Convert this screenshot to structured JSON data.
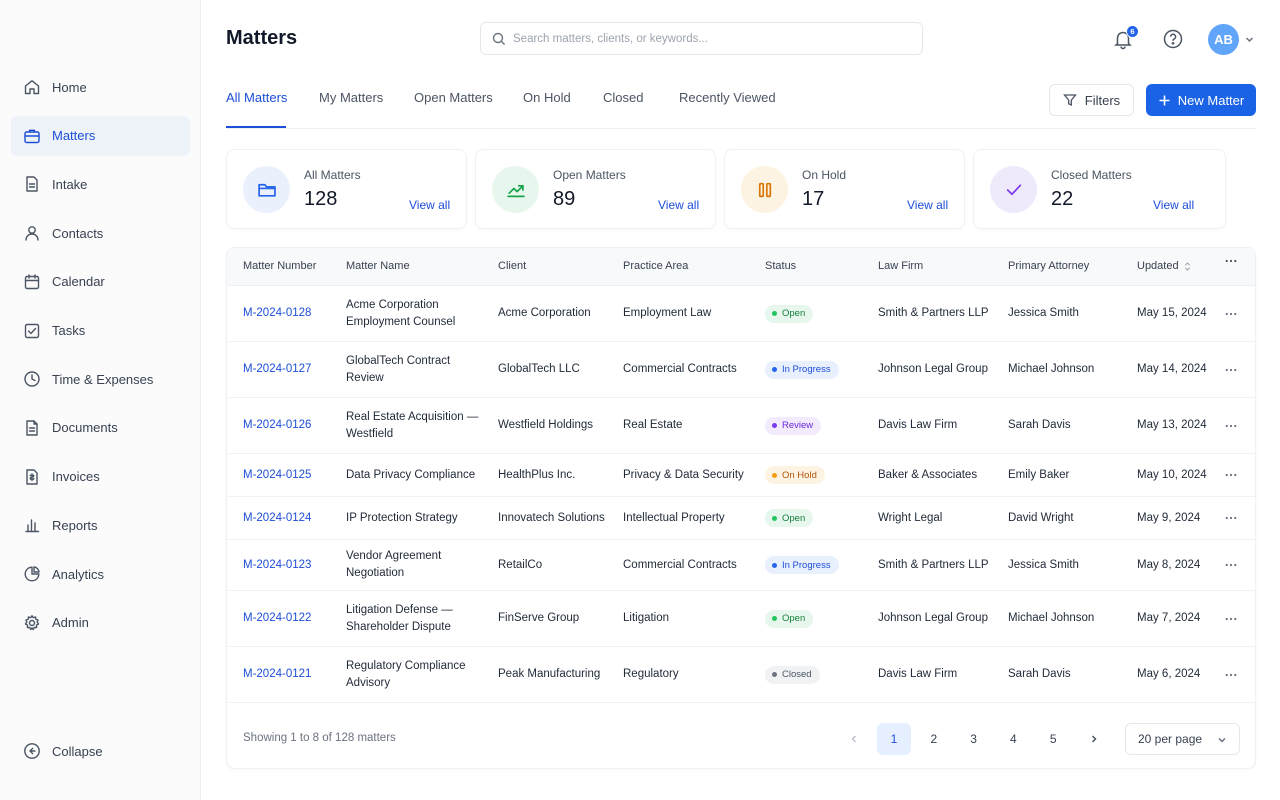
{
  "app": {
    "title": "Matters"
  },
  "sidebar": {
    "items": [
      {
        "label": "Home",
        "icon": "home-icon",
        "active": false
      },
      {
        "label": "Matters",
        "icon": "briefcase-icon",
        "active": true
      },
      {
        "label": "Intake",
        "icon": "intake-icon",
        "active": false
      },
      {
        "label": "Contacts",
        "icon": "user-icon",
        "active": false
      },
      {
        "label": "Calendar",
        "icon": "calendar-icon",
        "active": false
      },
      {
        "label": "Tasks",
        "icon": "checkbox-icon",
        "active": false
      },
      {
        "label": "Time & Expenses",
        "icon": "clock-icon",
        "active": false
      },
      {
        "label": "Documents",
        "icon": "document-icon",
        "active": false
      },
      {
        "label": "Invoices",
        "icon": "invoice-icon",
        "active": false
      },
      {
        "label": "Reports",
        "icon": "bar-chart-icon",
        "active": false
      },
      {
        "label": "Analytics",
        "icon": "pie-chart-icon",
        "active": false
      },
      {
        "label": "Admin",
        "icon": "gear-icon",
        "active": false
      }
    ],
    "collapse_label": "Collapse"
  },
  "search": {
    "placeholder": "Search matters, clients, or keywords..."
  },
  "notifications": {
    "count": "6"
  },
  "user": {
    "initials": "AB"
  },
  "tabs": [
    {
      "label": "All Matters",
      "active": true
    },
    {
      "label": "My Matters",
      "active": false
    },
    {
      "label": "Open Matters",
      "active": false
    },
    {
      "label": "On Hold",
      "active": false
    },
    {
      "label": "Closed",
      "active": false
    },
    {
      "label": "Recently Viewed",
      "active": false
    }
  ],
  "toolbar": {
    "filters_label": "Filters",
    "new_label": "New Matter"
  },
  "stats": [
    {
      "label": "All Matters",
      "value": "128",
      "link": "View all",
      "icon": "folder-icon",
      "icon_color": "#2563eb",
      "icon_bg": "#eaf1fd"
    },
    {
      "label": "Open Matters",
      "value": "89",
      "link": "View all",
      "icon": "trend-up-icon",
      "icon_color": "#16a34a",
      "icon_bg": "#e8f7ee"
    },
    {
      "label": "On Hold",
      "value": "17",
      "link": "View all",
      "icon": "pause-icon",
      "icon_color": "#d97706",
      "icon_bg": "#fdf3e2"
    },
    {
      "label": "Closed Matters",
      "value": "22",
      "link": "View all",
      "icon": "check-icon",
      "icon_color": "#7c3aed",
      "icon_bg": "#efe9fc"
    }
  ],
  "table": {
    "columns": [
      "Matter Number",
      "Matter Name",
      "Client",
      "Practice Area",
      "Status",
      "Law Firm",
      "Primary Attorney",
      "Updated"
    ],
    "rows": [
      {
        "number": "M-2024-0128",
        "name": "Acme Corporation Employment Counsel",
        "client": "Acme Corporation",
        "area": "Employment Law",
        "status": "Open",
        "firm": "Smith & Partners LLP",
        "attorney": "Jessica Smith",
        "updated": "May 15, 2024"
      },
      {
        "number": "M-2024-0127",
        "name": "GlobalTech Contract Review",
        "client": "GlobalTech LLC",
        "area": "Commercial Contracts",
        "status": "In Progress",
        "firm": "Johnson Legal Group",
        "attorney": "Michael Johnson",
        "updated": "May 14, 2024"
      },
      {
        "number": "M-2024-0126",
        "name": "Real Estate Acquisition — Westfield",
        "client": "Westfield Holdings",
        "area": "Real Estate",
        "status": "Review",
        "firm": "Davis Law Firm",
        "attorney": "Sarah Davis",
        "updated": "May 13, 2024"
      },
      {
        "number": "M-2024-0125",
        "name": "Data Privacy Compliance",
        "client": "HealthPlus Inc.",
        "area": "Privacy & Data Security",
        "status": "On Hold",
        "firm": "Baker & Associates",
        "attorney": "Emily Baker",
        "updated": "May 10, 2024"
      },
      {
        "number": "M-2024-0124",
        "name": "IP Protection Strategy",
        "client": "Innovatech Solutions",
        "area": "Intellectual Property",
        "status": "Open",
        "firm": "Wright Legal",
        "attorney": "David Wright",
        "updated": "May 9, 2024"
      },
      {
        "number": "M-2024-0123",
        "name": "Vendor Agreement Negotiation",
        "client": "RetailCo",
        "area": "Commercial Contracts",
        "status": "In Progress",
        "firm": "Smith & Partners LLP",
        "attorney": "Jessica Smith",
        "updated": "May 8, 2024"
      },
      {
        "number": "M-2024-0122",
        "name": "Litigation Defense — Shareholder Dispute",
        "client": "FinServe Group",
        "area": "Litigation",
        "status": "Open",
        "firm": "Johnson Legal Group",
        "attorney": "Michael Johnson",
        "updated": "May 7, 2024"
      },
      {
        "number": "M-2024-0121",
        "name": "Regulatory Compliance Advisory",
        "client": "Peak Manufacturing",
        "area": "Regulatory",
        "status": "Closed",
        "firm": "Davis Law Firm",
        "attorney": "Sarah Davis",
        "updated": "May 6, 2024"
      }
    ]
  },
  "status_colors": {
    "Open": {
      "bg": "#e8f7ee",
      "fg": "#15803d",
      "dot": "#22c55e"
    },
    "In Progress": {
      "bg": "#e8f0fe",
      "fg": "#1d4ed8",
      "dot": "#2563eb"
    },
    "Review": {
      "bg": "#f1ebfd",
      "fg": "#6d28d9",
      "dot": "#7c3aed"
    },
    "On Hold": {
      "bg": "#fdf3e2",
      "fg": "#b45309",
      "dot": "#f59e0b"
    },
    "Closed": {
      "bg": "#f1f2f4",
      "fg": "#4b5563",
      "dot": "#6b7280"
    }
  },
  "footer": {
    "summary": "Showing 1 to 8 of 128 matters",
    "pages": [
      "1",
      "2",
      "3",
      "4",
      "5"
    ],
    "current_page": "1",
    "per_page": "20 per page"
  }
}
